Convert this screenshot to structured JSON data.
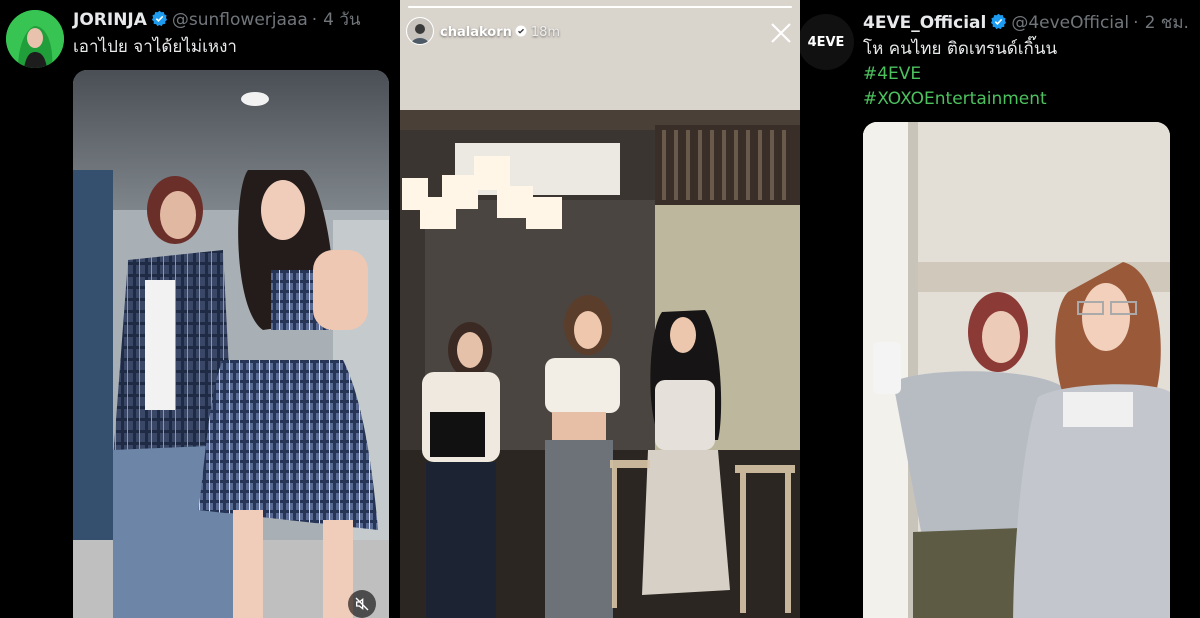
{
  "left_tweet": {
    "display_name": "JORINJA",
    "handle": "@sunflowerjaaa",
    "separator": "·",
    "time": "4 วัน",
    "text": "เอาไปย จาได้ยไม่เหงา",
    "verified_icon": "verified-badge-icon",
    "mute_icon": "muted-speaker-icon"
  },
  "story": {
    "username": "chalakorn",
    "time": "18m",
    "progress": 1.0,
    "verified_icon": "verified-badge-icon",
    "close_icon": "close-icon"
  },
  "right_tweet": {
    "display_name": "4EVE_Official",
    "handle": "@4eveOfficial",
    "separator": "·",
    "time": "2 ชม.",
    "text": "โห คนไทย ติดเทรนด์เกิ๊นน",
    "hashtags": [
      "#4EVE",
      "#XOXOEntertainment"
    ],
    "avatar_logo": "4EVE",
    "verified_icon": "verified-badge-icon"
  },
  "colors": {
    "background": "#000000",
    "text": "#e7e9ea",
    "muted": "#71767b",
    "verified": "#1d9bf0",
    "hashtag": "#4cc15e"
  }
}
